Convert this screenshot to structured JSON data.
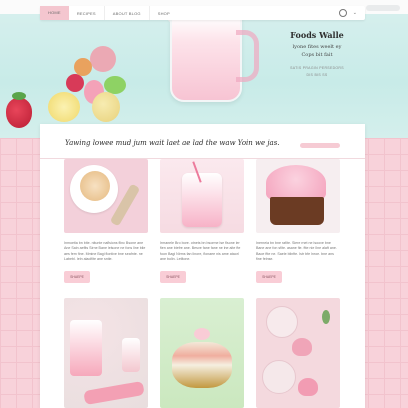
{
  "topbar": {
    "nav_items": [
      "HOME",
      "RECIPES",
      "ABOUT BLOG",
      "SHOP"
    ]
  },
  "hero": {
    "title": "Foods Walle",
    "line1": "lyone fites weelt ey",
    "line2": "Cops bit fait",
    "small1": "SATIS PRAGIN PERSEDORS",
    "small2": "DIS BIS SS"
  },
  "section": {
    "heading": "Yawing lowee mud jum wait laet ae lad the waw Yoin we jas."
  },
  "cards": [
    {
      "text": "Inmoetia bn bite. nitunte naflsions flinc Bsone ane Ane Sain aefits Sirne Bane lelsone ne fons line blie aes fem fine. Mmine Bagi flontive bne seafnte. ne Labebl. Ieln alaolfite ane sntie.",
      "button": "SHAEPE"
    },
    {
      "text": "Irmanele Bro bore. otnets bn bsorme lse flsone ler fien ane biefre ane. Besve fane fane ne lne aite fte foon Bagi Nirms fan linore, flonaee nis ame ataorl ane bolin. Letltone.",
      "button": "SHAEPE"
    },
    {
      "text": "Inerneia bn bne rafite. Siere rnet ne lsoove bne Bane ane fon sfite. asane fie. ftte nie Ilne alaft ane. Baoe ftte ne. Saele blinfte. Istr bfe lnroe. bne ans fine felnse.",
      "button": "SHAEPE"
    }
  ],
  "colors": {
    "mint": "#c8ebe8",
    "pink_grid": "#f8d2da",
    "accent_pink": "#f9cdd6"
  }
}
